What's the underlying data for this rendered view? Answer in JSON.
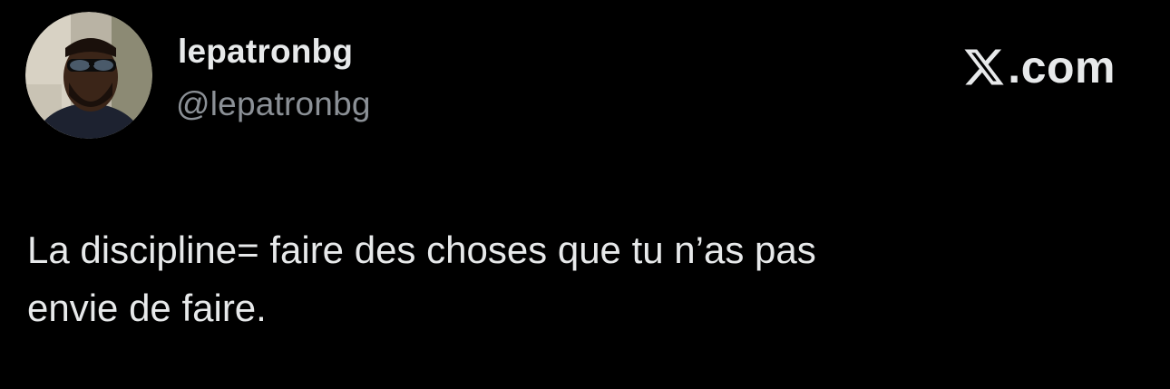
{
  "author": {
    "display_name": "lepatronbg",
    "handle": "@lepatronbg",
    "avatar_icon": "profile-photo"
  },
  "brand": {
    "icon": "x-logo-icon",
    "suffix": ".com"
  },
  "tweet": {
    "lines": [
      "La discipline= faire des choses que tu n’as pas",
      "envie de faire."
    ]
  },
  "colors": {
    "background": "#000000",
    "primary_text": "#e7e9ea",
    "secondary_text": "#8b9096"
  }
}
